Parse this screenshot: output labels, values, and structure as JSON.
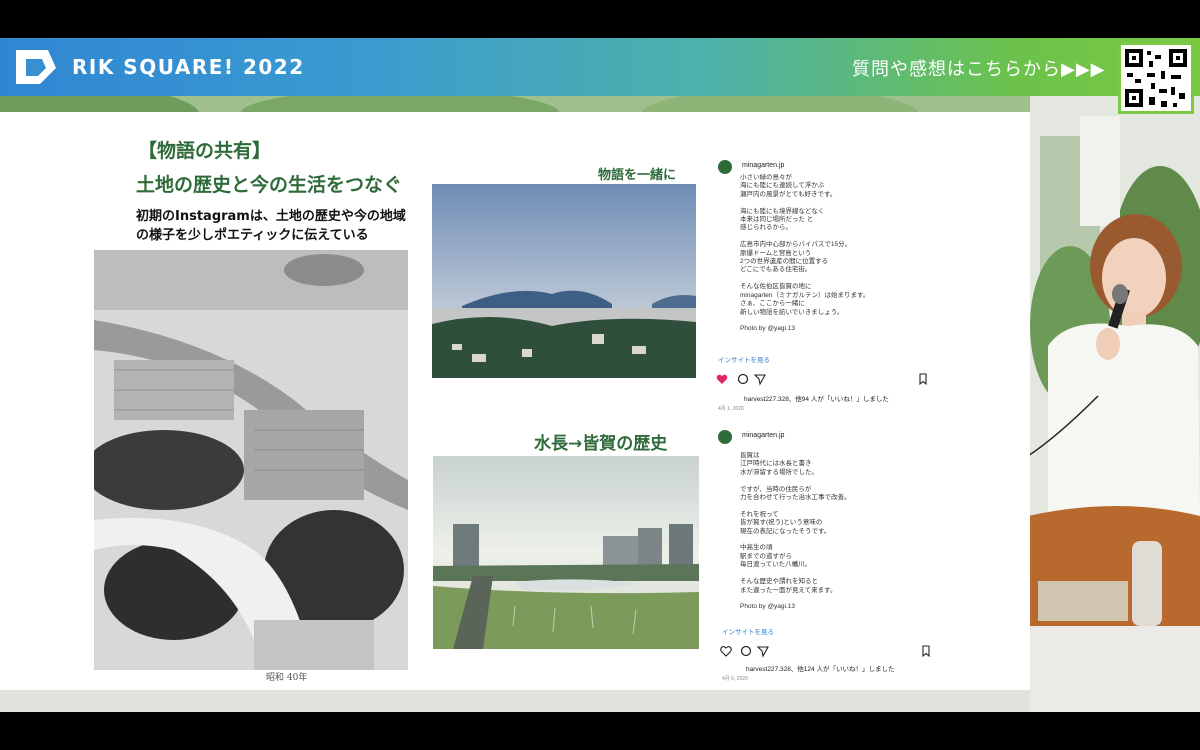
{
  "header": {
    "brand": "RIK SQUARE! 2022",
    "feedback_text": "質問や感想はこちらから▶▶▶"
  },
  "slide": {
    "heading_bracket": "【物語の共有】",
    "heading_main": "土地の歴史と今の生活をつなぐ",
    "description": "初期のInstagramは、土地の歴史や今の地域の様子を少しポエティックに伝えている",
    "label_story": "物語を一緒に",
    "label_history": "水長→皆賀の歴史",
    "photo_caption_hand": "昭和 40年"
  },
  "posts": [
    {
      "username": "minagarten.jp",
      "body": "小さい緑の島々が\n海にも陸にも連続して浮かぶ\n瀬戸内の風景がとても好きです。\n\n海にも陸にも境界線などなく\n本来は同じ場所だった と\n感じられるから。\n\n広島市内中心部からバイパスで15分。\n原爆ドームと宮島という\n2つの世界遺産の間に位置する\nどこにでもある住宅街。\n\nそんな佐伯区皆賀の地に\nminagarten（ミナガルテン）は始まります。\nさぁ、ここから一緒に\n新しい物語を紡いでいきましょう。\n\nPhoto by @yagi.13",
      "insight": "インサイトを見る",
      "likes": "harvest227.328、他94 人が「いいね！」しました",
      "date": "4月 1, 2020"
    },
    {
      "username": "minagarten.jp",
      "body": "皆賀は\n江戸時代には水長と書き\n水が滞留する場所でした。\n\nですが、当時の住民らが\n力を合わせて行った治水工事で改善。\n\nそれを祝って\n皆が賀す(祝う)という意味の\n現在の表記になったそうです。\n\n中高生の頃\n駅までの道すがら\n毎日渡っていた八幡川。\n\nそんな歴史や謂れを知ると\nまた違った一面が見えて来ます。\n\nPhoto by @yagi.13",
      "insight": "インサイトを見る",
      "likes": "harvest227.328、他124 人が「いいね！」しました",
      "date": "4月 6, 2020"
    }
  ],
  "colors": {
    "banner_start": "#2f86d3",
    "banner_end": "#7ac943",
    "slide_green": "#2f6b3a",
    "link_blue": "#2d7cc9",
    "like_red": "#e0245e"
  }
}
